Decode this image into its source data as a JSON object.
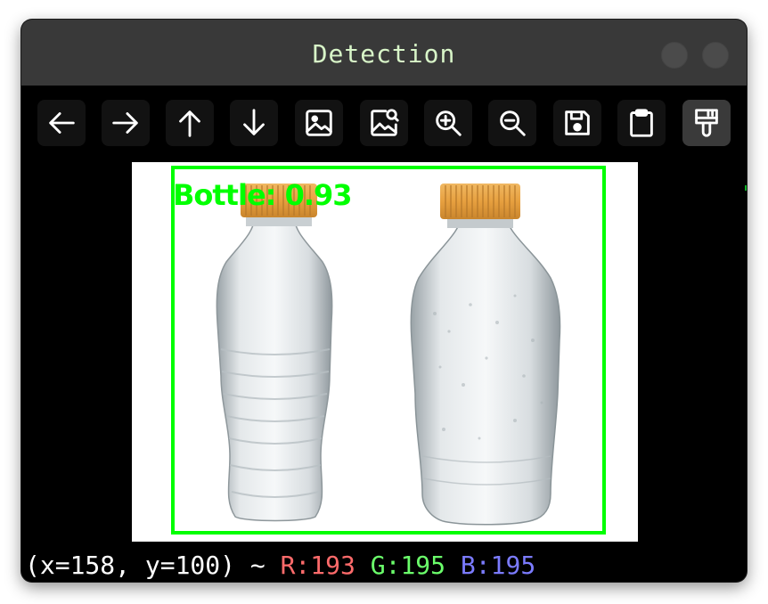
{
  "window": {
    "title": "Detection"
  },
  "toolbar": {
    "buttons": [
      {
        "icon": "arrow-left-icon"
      },
      {
        "icon": "arrow-right-icon"
      },
      {
        "icon": "arrow-up-icon"
      },
      {
        "icon": "arrow-down-icon"
      },
      {
        "icon": "image-icon"
      },
      {
        "icon": "image-search-icon"
      },
      {
        "icon": "zoom-in-icon"
      },
      {
        "icon": "zoom-out-icon"
      },
      {
        "icon": "save-icon"
      },
      {
        "icon": "clipboard-icon"
      },
      {
        "icon": "paint-brush-icon",
        "active": true
      }
    ]
  },
  "detection": {
    "label": "Bottle: 0.93",
    "box_color": "#00ff00"
  },
  "status": {
    "coords": "(x=158, y=100) ~",
    "r": "R:193",
    "g": "G:195",
    "b": "B:195",
    "r_color": "#ff6b6b",
    "g_color": "#6bff6b",
    "b_color": "#7b7bff"
  }
}
